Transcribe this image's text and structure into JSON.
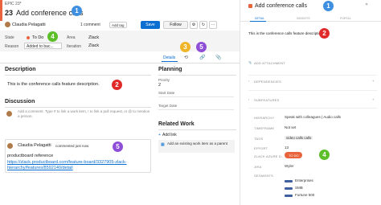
{
  "left": {
    "epic_label": "EPIC 23*",
    "item_number": "23",
    "title": "Add conference calls",
    "assignee": "Claudia Pelagatti",
    "comment_count": "1 comment",
    "add_tag": "Add tag",
    "save": "Save",
    "follow": "Follow",
    "state_label": "State",
    "state_value": "To Do",
    "reason_label": "Reason",
    "reason_value": "Added to bac...",
    "area_label": "Area",
    "area_value": "Zlack",
    "iteration_label": "Iteration",
    "iteration_value": "Zlack",
    "tab_details": "Details",
    "description_heading": "Description",
    "description_text": "This is the conference calls feature description.",
    "discussion_heading": "Discussion",
    "comment_placeholder": "Add a comment. Type # to link a work item, ! to link a pull request, or @ to mention a person.",
    "commenter_name": "Claudia Pelagatti",
    "commented_when": "commented just now",
    "comment_line1": "productboard reference",
    "comment_line2": "https://zlack.productboard.com/feature-board/3327905-zlack-",
    "comment_line3": "hierarchy/features/8592140/detail",
    "planning_heading": "Planning",
    "priority_label": "Priority",
    "priority_value": "2",
    "start_date_label": "Start Date",
    "target_date_label": "Target Date",
    "related_heading": "Related Work",
    "add_link": "Add link",
    "add_existing": "Add an existing work item as a parent"
  },
  "right": {
    "title": "Add conference calls",
    "tabs": [
      "DETAIL",
      "INSIGHTS",
      "PORTAL"
    ],
    "description": "This is the conference calls feature description.",
    "add_attachment": "ADD ATTACHMENT",
    "dependencies": "DEPENDENCIES",
    "subfeatures": "SUBFEATURES",
    "fields": [
      {
        "label": "HIERARCHY",
        "value": "Speak with colleagues  |  Audio calls"
      },
      {
        "label": "TIMEFRAME",
        "value": "Not set"
      },
      {
        "label": "TAGS",
        "value": "video calls   calls"
      },
      {
        "label": "EFFORT",
        "value": "13"
      },
      {
        "label": "ZLACK AZURE D...",
        "value": "TO DO"
      },
      {
        "label": "JIRA",
        "value": "Wyler"
      },
      {
        "label": "SEGMENTS",
        "value": ""
      }
    ],
    "segments": [
      "Enterprises",
      "SMB",
      "Fortune 500"
    ]
  },
  "badges": [
    "1",
    "2",
    "3",
    "4",
    "5"
  ],
  "colors": {
    "accent_orange": "#e8643c",
    "save_blue": "#0a6fd0",
    "state_orange": "#e8643c",
    "ado_blue": "#0078d4"
  }
}
